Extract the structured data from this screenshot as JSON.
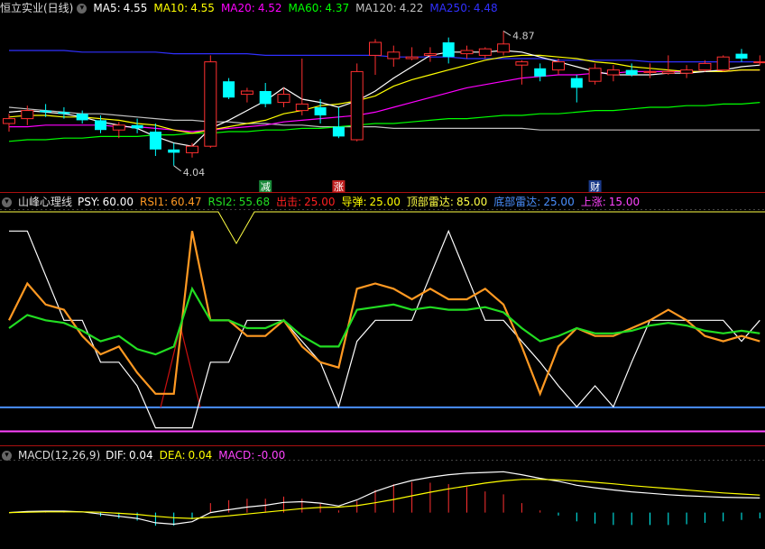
{
  "colors": {
    "ma5": "#ffffff",
    "ma10": "#ffff00",
    "ma20": "#ff00ff",
    "ma60": "#00ff00",
    "ma120": "#c0c0c0",
    "ma250": "#3030ff",
    "up": "#ff3030",
    "down": "#00ffff",
    "psy": "#ffffff",
    "rsi1": "#ff9922",
    "rsi2": "#22dd22",
    "sell": "#ff2020",
    "rebound": "#ffff00",
    "top": "#ffff44",
    "bottom": "#4a90ff",
    "rise": "#ff44ff",
    "dif": "#ffffff",
    "dea": "#ffff00",
    "macd": "#ff44ff"
  },
  "icons": [
    "chevron-down-icon",
    "chevron-down-icon",
    "chevron-down-icon"
  ],
  "price_panel": {
    "title": "恒立实业(日线)",
    "ma_legend": [
      {
        "label": "MA5:",
        "value": "4.55",
        "color": "#ffffff"
      },
      {
        "label": "MA10:",
        "value": "4.55",
        "color": "#ffff00"
      },
      {
        "label": "MA20:",
        "value": "4.52",
        "color": "#ff00ff"
      },
      {
        "label": "MA60:",
        "value": "4.37",
        "color": "#00ff00"
      },
      {
        "label": "MA120:",
        "value": "4.22",
        "color": "#c0c0c0"
      },
      {
        "label": "MA250:",
        "value": "4.48",
        "color": "#3030ff"
      }
    ],
    "high_label": "4.87",
    "low_label": "4.04",
    "markers": [
      {
        "text": "减",
        "bg": "#1a8a3a",
        "index": 14
      },
      {
        "text": "涨",
        "bg": "#c02020",
        "index": 18
      },
      {
        "text": "财",
        "bg": "#1a3a8a",
        "index": 32
      }
    ]
  },
  "indicator_panel": {
    "title": "山峰心理线",
    "legend": [
      {
        "label": "PSY:",
        "value": "60.00",
        "color": "#ffffff"
      },
      {
        "label": "RSI1:",
        "value": "60.47",
        "color": "#ff9922"
      },
      {
        "label": "RSI2:",
        "value": "55.68",
        "color": "#22dd22"
      },
      {
        "label": "出击:",
        "value": "25.00",
        "color": "#ff2020"
      },
      {
        "label": "导弹:",
        "value": "25.00",
        "color": "#ffff00"
      },
      {
        "label": "顶部雷达:",
        "value": "85.00",
        "color": "#ffff44"
      },
      {
        "label": "底部雷达:",
        "value": "25.00",
        "color": "#4a90ff"
      },
      {
        "label": "上涨:",
        "value": "15.00",
        "color": "#ff44ff"
      }
    ]
  },
  "macd_panel": {
    "title": "MACD(12,26,9)",
    "legend": [
      {
        "label": "DIF:",
        "value": "0.04",
        "color": "#ffffff"
      },
      {
        "label": "DEA:",
        "value": "0.04",
        "color": "#ffff00"
      },
      {
        "label": "MACD:",
        "value": "-0.00",
        "color": "#ff44ff"
      }
    ]
  },
  "chart_data": [
    {
      "type": "candlestick",
      "ylim": [
        3.95,
        4.95
      ],
      "candles": [
        [
          4.3,
          4.36,
          4.25,
          4.33
        ],
        [
          4.33,
          4.41,
          4.29,
          4.38
        ],
        [
          4.38,
          4.42,
          4.34,
          4.37
        ],
        [
          4.37,
          4.4,
          4.33,
          4.36
        ],
        [
          4.36,
          4.38,
          4.3,
          4.32
        ],
        [
          4.32,
          4.35,
          4.24,
          4.26
        ],
        [
          4.26,
          4.31,
          4.21,
          4.29
        ],
        [
          4.29,
          4.33,
          4.24,
          4.27
        ],
        [
          4.25,
          4.3,
          4.1,
          4.14
        ],
        [
          4.14,
          4.18,
          4.04,
          4.12
        ],
        [
          4.12,
          4.18,
          4.09,
          4.16
        ],
        [
          4.16,
          4.72,
          4.15,
          4.68
        ],
        [
          4.56,
          4.58,
          4.45,
          4.46
        ],
        [
          4.48,
          4.52,
          4.43,
          4.5
        ],
        [
          4.5,
          4.55,
          4.4,
          4.42
        ],
        [
          4.43,
          4.52,
          4.4,
          4.48
        ],
        [
          4.38,
          4.7,
          4.35,
          4.42
        ],
        [
          4.4,
          4.45,
          4.3,
          4.35
        ],
        [
          4.28,
          4.4,
          4.21,
          4.22
        ],
        [
          4.2,
          4.67,
          4.19,
          4.62
        ],
        [
          4.72,
          4.82,
          4.6,
          4.8
        ],
        [
          4.7,
          4.78,
          4.65,
          4.74
        ],
        [
          4.7,
          4.77,
          4.69,
          4.71
        ],
        [
          4.72,
          4.77,
          4.68,
          4.73
        ],
        [
          4.8,
          4.83,
          4.67,
          4.71
        ],
        [
          4.73,
          4.78,
          4.7,
          4.75
        ],
        [
          4.72,
          4.77,
          4.7,
          4.76
        ],
        [
          4.74,
          4.87,
          4.72,
          4.79
        ],
        [
          4.66,
          4.69,
          4.54,
          4.68
        ],
        [
          4.64,
          4.67,
          4.56,
          4.59
        ],
        [
          4.63,
          4.7,
          4.6,
          4.68
        ],
        [
          4.58,
          4.6,
          4.43,
          4.52
        ],
        [
          4.56,
          4.67,
          4.54,
          4.64
        ],
        [
          4.6,
          4.66,
          4.56,
          4.63
        ],
        [
          4.63,
          4.67,
          4.59,
          4.6
        ],
        [
          4.62,
          4.67,
          4.58,
          4.62
        ],
        [
          4.61,
          4.72,
          4.6,
          4.62
        ],
        [
          4.61,
          4.66,
          4.58,
          4.63
        ],
        [
          4.63,
          4.69,
          4.62,
          4.67
        ],
        [
          4.63,
          4.72,
          4.62,
          4.71
        ],
        [
          4.73,
          4.76,
          4.68,
          4.7
        ],
        [
          4.68,
          4.72,
          4.66,
          4.68
        ]
      ],
      "ma5": [
        4.37,
        4.38,
        4.37,
        4.36,
        4.34,
        4.31,
        4.29,
        4.27,
        4.22,
        4.18,
        4.16,
        4.27,
        4.32,
        4.38,
        4.44,
        4.52,
        4.45,
        4.43,
        4.4,
        4.44,
        4.5,
        4.58,
        4.65,
        4.72,
        4.74,
        4.74,
        4.74,
        4.75,
        4.74,
        4.71,
        4.68,
        4.65,
        4.62,
        4.6,
        4.6,
        4.6,
        4.61,
        4.61,
        4.62,
        4.63,
        4.65,
        4.66
      ],
      "ma10": [
        4.34,
        4.35,
        4.35,
        4.34,
        4.34,
        4.33,
        4.32,
        4.3,
        4.29,
        4.26,
        4.24,
        4.26,
        4.28,
        4.3,
        4.32,
        4.36,
        4.38,
        4.41,
        4.42,
        4.44,
        4.47,
        4.53,
        4.57,
        4.6,
        4.63,
        4.66,
        4.69,
        4.71,
        4.72,
        4.72,
        4.71,
        4.7,
        4.68,
        4.67,
        4.65,
        4.64,
        4.63,
        4.62,
        4.62,
        4.62,
        4.63,
        4.63
      ],
      "ma20": [
        4.28,
        4.28,
        4.29,
        4.29,
        4.29,
        4.29,
        4.28,
        4.28,
        4.27,
        4.26,
        4.25,
        4.26,
        4.27,
        4.28,
        4.29,
        4.31,
        4.32,
        4.33,
        4.34,
        4.35,
        4.37,
        4.4,
        4.43,
        4.46,
        4.49,
        4.52,
        4.54,
        4.56,
        4.58,
        4.59,
        4.6,
        4.6,
        4.61,
        4.61,
        4.62,
        4.62,
        4.62,
        4.62,
        4.62,
        4.62,
        4.63,
        4.63
      ],
      "ma60": [
        4.19,
        4.2,
        4.2,
        4.21,
        4.21,
        4.22,
        4.22,
        4.22,
        4.23,
        4.23,
        4.24,
        4.24,
        4.25,
        4.25,
        4.26,
        4.26,
        4.27,
        4.27,
        4.28,
        4.29,
        4.3,
        4.3,
        4.31,
        4.32,
        4.33,
        4.33,
        4.34,
        4.35,
        4.35,
        4.36,
        4.36,
        4.37,
        4.38,
        4.38,
        4.39,
        4.4,
        4.4,
        4.41,
        4.41,
        4.42,
        4.42,
        4.43
      ],
      "ma120": [
        4.4,
        4.39,
        4.38,
        4.37,
        4.36,
        4.36,
        4.35,
        4.34,
        4.33,
        4.32,
        4.32,
        4.31,
        4.31,
        4.3,
        4.3,
        4.29,
        4.29,
        4.28,
        4.28,
        4.28,
        4.28,
        4.27,
        4.27,
        4.27,
        4.27,
        4.27,
        4.27,
        4.27,
        4.27,
        4.26,
        4.26,
        4.26,
        4.26,
        4.26,
        4.26,
        4.26,
        4.26,
        4.26,
        4.26,
        4.26,
        4.26,
        4.26
      ],
      "ma250": [
        4.75,
        4.75,
        4.75,
        4.75,
        4.74,
        4.74,
        4.74,
        4.74,
        4.74,
        4.73,
        4.73,
        4.73,
        4.73,
        4.73,
        4.72,
        4.72,
        4.72,
        4.72,
        4.72,
        4.72,
        4.72,
        4.71,
        4.71,
        4.71,
        4.71,
        4.7,
        4.7,
        4.7,
        4.7,
        4.7,
        4.69,
        4.69,
        4.69,
        4.69,
        4.69,
        4.68,
        4.68,
        4.68,
        4.68,
        4.68,
        4.68,
        4.68
      ]
    },
    {
      "type": "line",
      "ylim": [
        10,
        100
      ],
      "psy": [
        92,
        92,
        75,
        58,
        58,
        42,
        42,
        33,
        17,
        17,
        17,
        42,
        42,
        58,
        58,
        58,
        50,
        42,
        25,
        50,
        58,
        58,
        58,
        75,
        92,
        75,
        58,
        58,
        50,
        42,
        33,
        25,
        33,
        25,
        42,
        58,
        58,
        58,
        58,
        58,
        50,
        58
      ],
      "rsi1": [
        58,
        72,
        64,
        62,
        52,
        45,
        48,
        38,
        30,
        30,
        92,
        58,
        58,
        52,
        52,
        58,
        48,
        42,
        40,
        70,
        72,
        70,
        66,
        70,
        66,
        66,
        70,
        64,
        48,
        30,
        48,
        55,
        52,
        52,
        55,
        58,
        62,
        58,
        52,
        50,
        52,
        50
      ],
      "rsi2": [
        55,
        60,
        58,
        57,
        54,
        50,
        52,
        47,
        45,
        48,
        70,
        58,
        58,
        55,
        55,
        58,
        52,
        48,
        48,
        62,
        63,
        64,
        62,
        63,
        62,
        62,
        63,
        61,
        55,
        50,
        52,
        55,
        53,
        53,
        54,
        56,
        57,
        56,
        54,
        53,
        54,
        53
      ],
      "bottom_radar": 25,
      "top_radar": 85,
      "rise": 15
    },
    {
      "type": "macd",
      "ylim": [
        -0.09,
        0.14
      ],
      "dif": [
        0.0,
        0.003,
        0.004,
        0.004,
        0.002,
        -0.004,
        -0.01,
        -0.016,
        -0.028,
        -0.032,
        -0.025,
        0.0,
        0.008,
        0.015,
        0.02,
        0.028,
        0.03,
        0.026,
        0.018,
        0.035,
        0.058,
        0.075,
        0.088,
        0.097,
        0.104,
        0.108,
        0.11,
        0.112,
        0.104,
        0.094,
        0.086,
        0.075,
        0.068,
        0.062,
        0.057,
        0.053,
        0.049,
        0.046,
        0.044,
        0.042,
        0.041,
        0.04
      ],
      "dea": [
        0.0,
        0.001,
        0.002,
        0.002,
        0.002,
        0.001,
        -0.002,
        -0.005,
        -0.01,
        -0.014,
        -0.016,
        -0.013,
        -0.009,
        -0.004,
        0.001,
        0.006,
        0.011,
        0.014,
        0.015,
        0.019,
        0.027,
        0.036,
        0.046,
        0.056,
        0.065,
        0.073,
        0.081,
        0.087,
        0.091,
        0.091,
        0.09,
        0.087,
        0.083,
        0.079,
        0.074,
        0.07,
        0.066,
        0.062,
        0.058,
        0.054,
        0.051,
        0.048
      ],
      "macd": [
        0.0,
        0.004,
        0.004,
        0.004,
        0.0,
        -0.01,
        -0.016,
        -0.022,
        -0.036,
        -0.036,
        -0.018,
        0.026,
        0.034,
        0.038,
        0.038,
        0.044,
        0.038,
        0.024,
        0.006,
        0.032,
        0.062,
        0.078,
        0.084,
        0.082,
        0.078,
        0.07,
        0.058,
        0.05,
        0.026,
        0.006,
        -0.008,
        -0.024,
        -0.03,
        -0.034,
        -0.034,
        -0.034,
        -0.034,
        -0.032,
        -0.028,
        -0.024,
        -0.02,
        -0.016
      ]
    }
  ]
}
